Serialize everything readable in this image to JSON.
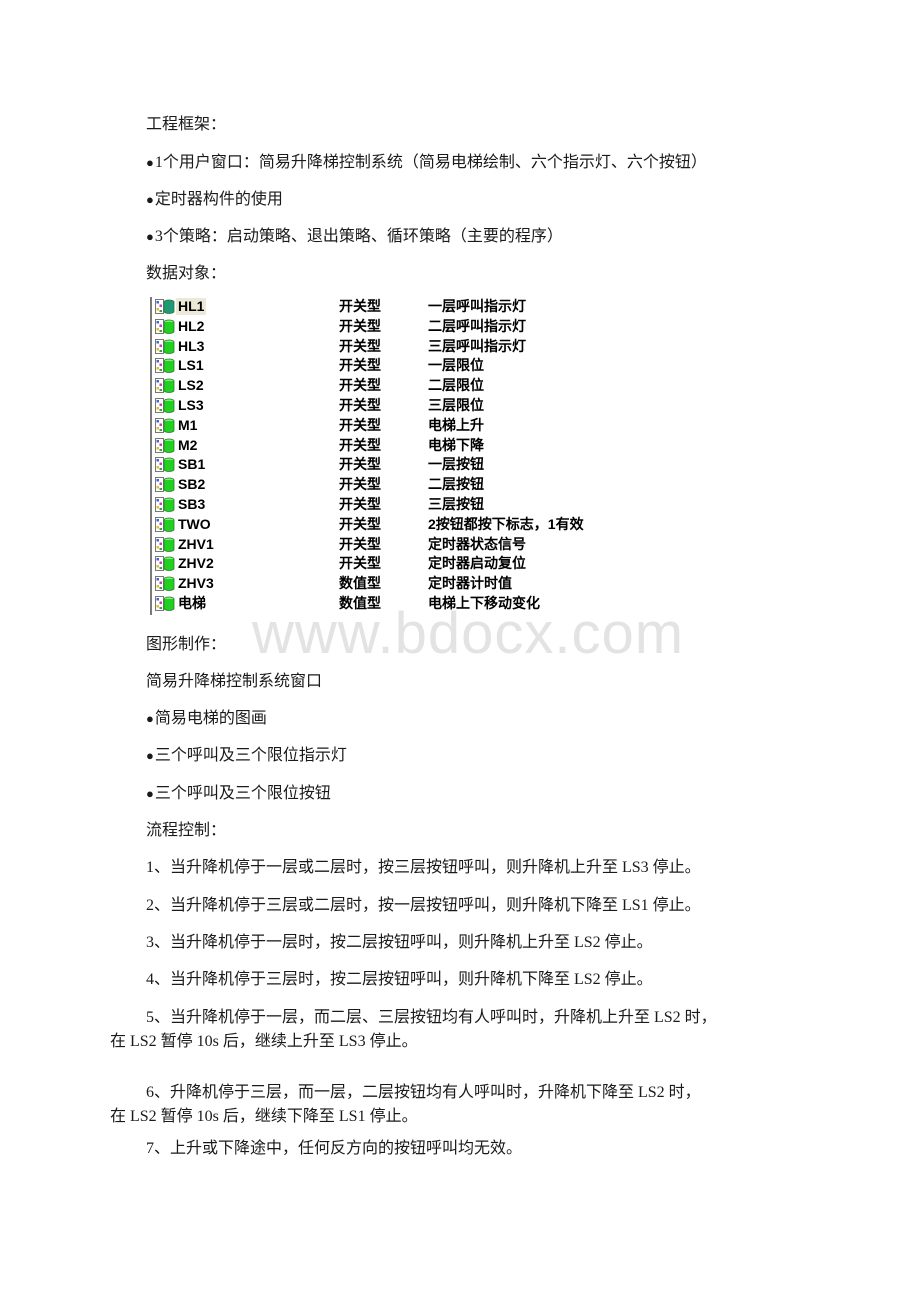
{
  "document": {
    "section_framework": {
      "heading": "工程框架：",
      "bullets": [
        "1个用户窗口：简易升降梯控制系统（简易电梯绘制、六个指示灯、六个按钮）",
        "定时器构件的使用",
        "3个策略：启动策略、退出策略、循环策略（主要的程序）"
      ]
    },
    "section_data_objects": {
      "heading": "数据对象：",
      "objects": [
        {
          "name": "HL1",
          "type": "开关型",
          "description": "一层呼叫指示灯",
          "selected": true
        },
        {
          "name": "HL2",
          "type": "开关型",
          "description": "二层呼叫指示灯"
        },
        {
          "name": "HL3",
          "type": "开关型",
          "description": "三层呼叫指示灯"
        },
        {
          "name": "LS1",
          "type": "开关型",
          "description": "一层限位"
        },
        {
          "name": "LS2",
          "type": "开关型",
          "description": "二层限位"
        },
        {
          "name": "LS3",
          "type": "开关型",
          "description": "三层限位"
        },
        {
          "name": "M1",
          "type": "开关型",
          "description": "电梯上升"
        },
        {
          "name": "M2",
          "type": "开关型",
          "description": "电梯下降"
        },
        {
          "name": "SB1",
          "type": "开关型",
          "description": "一层按钮"
        },
        {
          "name": "SB2",
          "type": "开关型",
          "description": "二层按钮"
        },
        {
          "name": "SB3",
          "type": "开关型",
          "description": "三层按钮"
        },
        {
          "name": "TWO",
          "type": "开关型",
          "description": "2按钮都按下标志，1有效"
        },
        {
          "name": "ZHV1",
          "type": "开关型",
          "description": "定时器状态信号"
        },
        {
          "name": "ZHV2",
          "type": "开关型",
          "description": "定时器启动复位"
        },
        {
          "name": "ZHV3",
          "type": "数值型",
          "description": "定时器计时值"
        },
        {
          "name": "电梯",
          "type": "数值型",
          "description": "电梯上下移动变化"
        }
      ]
    },
    "section_graphics": {
      "heading": "图形制作：",
      "window_title": "简易升降梯控制系统窗口",
      "bullets": [
        "简易电梯的图画",
        "三个呼叫及三个限位指示灯",
        "三个呼叫及三个限位按钮"
      ]
    },
    "section_flow": {
      "heading": "流程控制：",
      "rules": [
        "1、当升降机停于一层或二层时，按三层按钮呼叫，则升降机上升至 LS3 停止。",
        "2、当升降机停于三层或二层时，按一层按钮呼叫，则升降机下降至 LS1 停止。",
        "3、当升降机停于一层时，按二层按钮呼叫，则升降机上升至 LS2 停止。",
        "4、当升降机停于三层时，按二层按钮呼叫，则升降机下降至 LS2 停止。"
      ],
      "rule5": {
        "line1": "5、当升降机停于一层，而二层、三层按钮均有人呼叫时，升降机上升至 LS2 时，",
        "line2": "在 LS2 暂停 10s 后，继续上升至 LS3 停止。"
      },
      "rule6": {
        "line1": "6、升降机停于三层，而一层，二层按钮均有人呼叫时，升降机下降至 LS2 时，",
        "line2": "在 LS2 暂停 10s 后，继续下降至 LS1 停止。"
      },
      "rule7": "7、上升或下降途中，任何反方向的按钮呼叫均无效。"
    },
    "watermark": "www.bdocx.com",
    "icons": {
      "object_icon": "data-object-icon"
    }
  }
}
